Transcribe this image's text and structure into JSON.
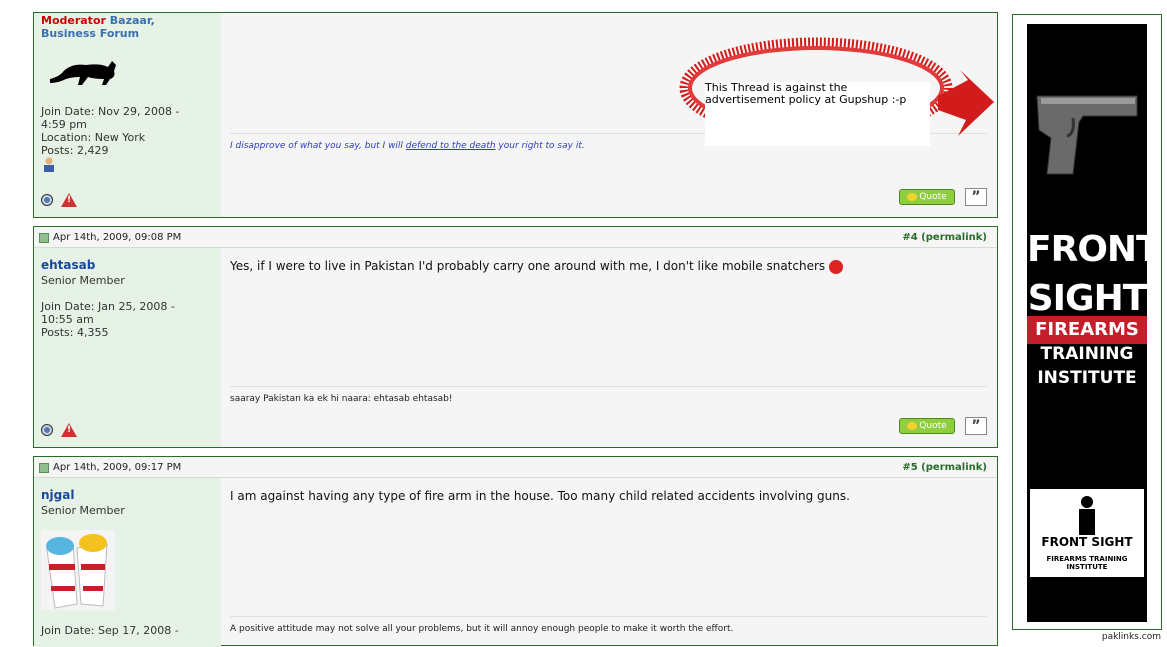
{
  "posts": [
    {
      "user_rank_moderator": "Moderator",
      "user_rank_forums": "Bazaar, Business Forum",
      "join_date": "Join Date: Nov 29, 2008 - 4:59 pm",
      "location": "Location: New York",
      "posts": "Posts: 2,429",
      "sig_pre": "I disapprove of what you say, but I will ",
      "sig_link": "defend to the death",
      "sig_post": " your right to say it.",
      "quote_label": "Quote"
    },
    {
      "date": "Apr 14th, 2009, 09:08 PM",
      "number": "#4",
      "permalink": "permalink",
      "username": "ehtasab",
      "title": "Senior Member",
      "join_date": "Join Date: Jan 25, 2008 - 10:55 am",
      "posts": "Posts: 4,355",
      "message": "Yes, if I were to live in Pakistan I'd probably carry one around with me, I don't like mobile snatchers",
      "signature": "saaray Pakistan ka ek hi naara: ehtasab ehtasab!",
      "quote_label": "Quote"
    },
    {
      "date": "Apr 14th, 2009, 09:17 PM",
      "number": "#5",
      "permalink": "permalink",
      "username": "njgal",
      "title": "Senior Member",
      "join_date": "Join Date: Sep 17, 2008 -",
      "message": "I am against having any type of fire arm in the house. Too many child related accidents involving guns.",
      "signature": "A positive attitude may not solve all your problems, but it will annoy enough people to make it worth the effort."
    }
  ],
  "callout": {
    "text": "This Thread is against the advertisement policy at Gupshup :-p"
  },
  "ad": {
    "title1": "Front",
    "title2": "Sight",
    "band": "Firearms",
    "line1": "Training",
    "line2": "Institute",
    "logo_text": "FRONT SIGHT",
    "logo_sub": "FIREARMS TRAINING INSTITUTE"
  },
  "watermark": "paklinks.com",
  "colors": {
    "border_green": "#2a6b2a",
    "username_blue": "#17479e",
    "moderator_red": "#cc0000",
    "ad_red": "#c41e2a"
  }
}
